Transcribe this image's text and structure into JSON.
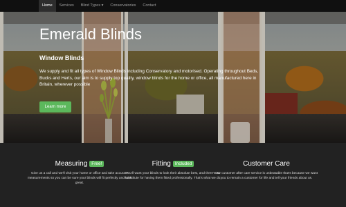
{
  "nav": {
    "items": [
      {
        "label": "Home",
        "active": true
      },
      {
        "label": "Services",
        "active": false
      },
      {
        "label": "Blind Types ▾",
        "active": false
      },
      {
        "label": "Conservatories",
        "active": false
      },
      {
        "label": "Contact",
        "active": false
      }
    ]
  },
  "hero": {
    "title": "Emerald Blinds",
    "subtitle": "Window Blinds",
    "description": "We supply and fit all types of Window Blinds including Conservatory and motorised. Operating throughout Beds, Bucks and Herts, our aim is to supply top quality, window blinds for the home or office, all manufactured here in Britain, wherever possible",
    "button_label": "Learn more"
  },
  "features": [
    {
      "title": "Measuring",
      "badge": "Free!",
      "text": "Give us a call and we'll visit your home or office and take accurate measurements so you can be sure your blinds will fit perfectly and look great."
    },
    {
      "title": "Fitting",
      "badge": "Included",
      "text": "You'll want your blinds to look their absolute best, and there's no substitute for having them fitted professionally. That's what we do."
    },
    {
      "title": "Customer Care",
      "badge": "",
      "text": "Our customer after care service is unbeatable that's because we want you to remain a customer for life and tell your friends about us."
    }
  ],
  "colors": {
    "accent": "#5cb85c",
    "navbar": "#101010",
    "background": "#222222"
  }
}
